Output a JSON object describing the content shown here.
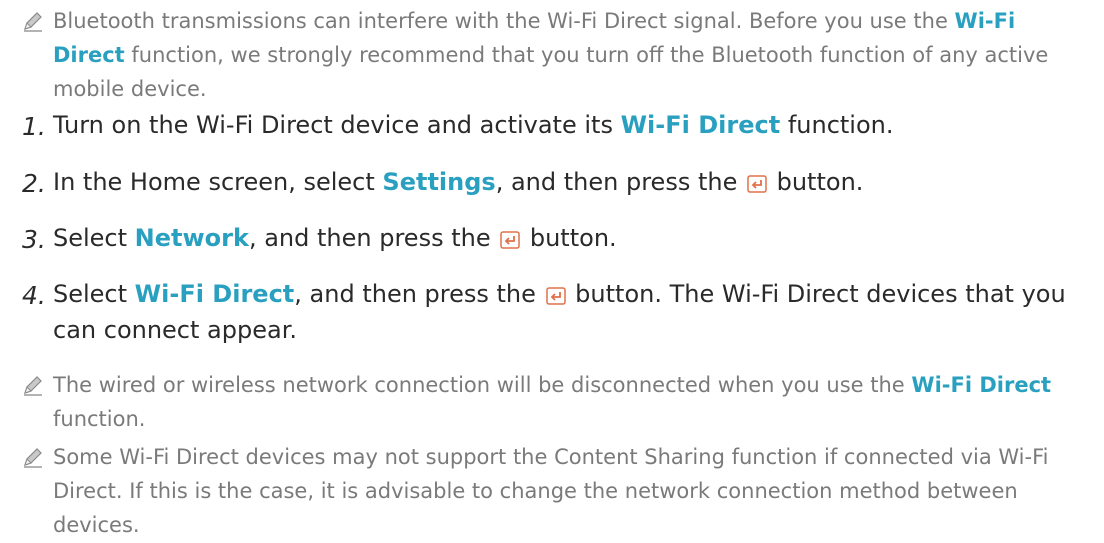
{
  "note1": {
    "icon": "pencil-note-icon",
    "part1": "Bluetooth transmissions can interfere with the Wi-Fi Direct signal. Before you use the ",
    "hl1": "Wi-Fi Direct",
    "part2": " function, we strongly recommend that you turn off the Bluetooth function of any active mobile device."
  },
  "steps": [
    {
      "num": "1.",
      "part1": "Turn on the Wi-Fi Direct device and activate its ",
      "hl1": "Wi-Fi Direct",
      "part2": " function."
    },
    {
      "num": "2.",
      "part1": "In the Home screen, select ",
      "hl1": "Settings",
      "part2": ", and then press the ",
      "icon": "enter-button-icon",
      "part3": " button."
    },
    {
      "num": "3.",
      "part1": "Select ",
      "hl1": "Network",
      "part2": ", and then press the ",
      "icon": "enter-button-icon",
      "part3": " button."
    },
    {
      "num": "4.",
      "part1": "Select ",
      "hl1": "Wi-Fi Direct",
      "part2": ", and then press the ",
      "icon": "enter-button-icon",
      "part3": " button. The Wi-Fi Direct devices that you can connect appear."
    }
  ],
  "note2": {
    "icon": "pencil-note-icon",
    "part1": "The wired or wireless network connection will be disconnected when you use the ",
    "hl1": "Wi-Fi Direct",
    "part2": " function."
  },
  "note3": {
    "icon": "pencil-note-icon",
    "text": "Some Wi-Fi Direct devices may not support the Content Sharing function if connected via Wi-Fi Direct. If this is the case, it is advisable to change the network connection method between devices."
  },
  "colors": {
    "highlight": "#2aa0c0",
    "note_text": "#7a7a7a",
    "body_text": "#2a2a2a"
  }
}
